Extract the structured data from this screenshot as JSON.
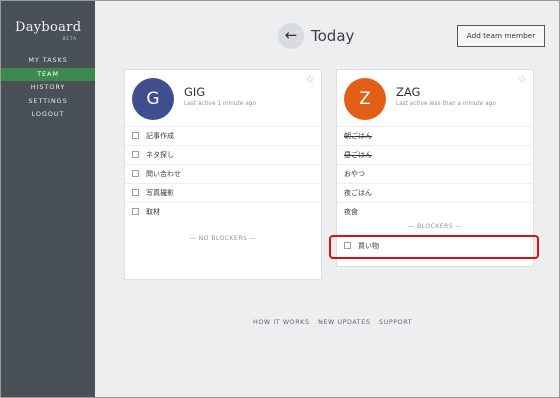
{
  "sidebar": {
    "brand": "Dayboard",
    "beta": "BETA",
    "items": [
      {
        "label": "MY TASKS"
      },
      {
        "label": "TEAM"
      },
      {
        "label": "HISTORY"
      },
      {
        "label": "SETTINGS"
      },
      {
        "label": "LOGOUT"
      }
    ],
    "active_index": 1
  },
  "header": {
    "back_icon": "←",
    "title": "Today",
    "add_button": "Add team member"
  },
  "members": [
    {
      "initial": "G",
      "name": "GIG",
      "last_active": "Last active 1 minute ago",
      "avatar_color": "#3f4e8f",
      "tasks": [
        {
          "text": "記事作成",
          "done": false
        },
        {
          "text": "ネタ探し",
          "done": false
        },
        {
          "text": "問い合わせ",
          "done": false
        },
        {
          "text": "写真撮影",
          "done": false
        },
        {
          "text": "取材",
          "done": false
        }
      ],
      "no_blockers": "— NO BLOCKERS —"
    },
    {
      "initial": "Z",
      "name": "ZAG",
      "last_active": "Last active less than a minute ago",
      "avatar_color": "#e35f16",
      "tasks": [
        {
          "text": "朝ごはん",
          "done": true
        },
        {
          "text": "昼ごはん",
          "done": true
        },
        {
          "text": "おやつ",
          "done": false
        },
        {
          "text": "夜ごはん",
          "done": false
        },
        {
          "text": "夜食",
          "done": false
        }
      ],
      "blockers_label": "— BLOCKERS —",
      "blockers": [
        {
          "text": "買い物",
          "done": false
        }
      ]
    }
  ],
  "footer": {
    "links": [
      "HOW IT WORKS",
      "NEW UPDATES",
      "SUPPORT"
    ]
  },
  "colors": {
    "sidebar_bg": "#4a5058",
    "active_nav": "#3d8a4f",
    "highlight": "#e01010"
  }
}
